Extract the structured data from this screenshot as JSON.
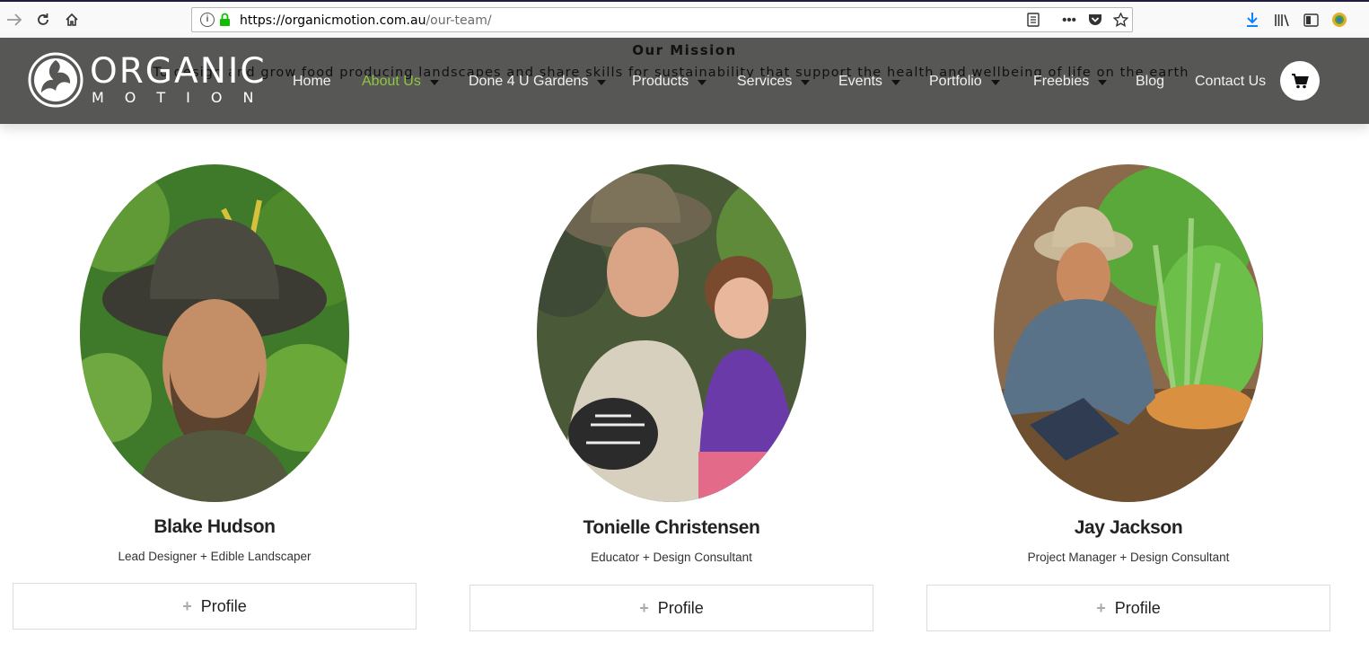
{
  "browser": {
    "url_host": "https://organicmotion.com.au",
    "url_path": "/our-team/"
  },
  "header": {
    "mission_title": "Our Mission",
    "mission_text": "To design and grow food producing landscapes and share skills for sustainability that support the health and wellbeing of life on the earth",
    "logo_word": "ORGANIC",
    "logo_sub": "MOTION",
    "nav": [
      {
        "label": "Home",
        "has_dropdown": false,
        "active": false
      },
      {
        "label": "About Us",
        "has_dropdown": true,
        "active": true
      },
      {
        "label": "Done 4 U Gardens",
        "has_dropdown": true,
        "active": false
      },
      {
        "label": "Products",
        "has_dropdown": true,
        "active": false
      },
      {
        "label": "Services",
        "has_dropdown": true,
        "active": false
      },
      {
        "label": "Events",
        "has_dropdown": true,
        "active": false
      },
      {
        "label": "Portfolio",
        "has_dropdown": true,
        "active": false
      },
      {
        "label": "Freebies",
        "has_dropdown": true,
        "active": false
      },
      {
        "label": "Blog",
        "has_dropdown": false,
        "active": false
      },
      {
        "label": "Contact Us",
        "has_dropdown": false,
        "active": false
      }
    ],
    "active_color": "#8dc63f"
  },
  "team": [
    {
      "name": "Blake Hudson",
      "role": "Lead Designer + Edible Landscaper",
      "button": "Profile"
    },
    {
      "name": "Tonielle Christensen",
      "role": "Educator + Design Consultant",
      "button": "Profile"
    },
    {
      "name": "Jay Jackson",
      "role": "Project Manager + Design Consultant",
      "button": "Profile"
    }
  ]
}
